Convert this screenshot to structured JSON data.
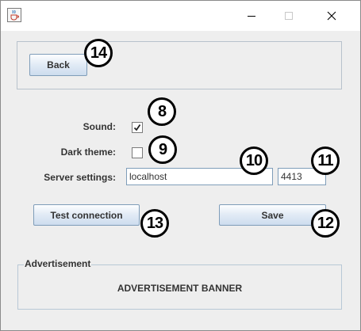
{
  "window": {
    "title": "",
    "icon": "java-cup-icon",
    "controls": {
      "minimize": "minimize-icon",
      "maximize": "maximize-icon",
      "close": "close-icon"
    }
  },
  "nav": {
    "back_label": "Back"
  },
  "settings": {
    "sound_label": "Sound:",
    "sound_checked": true,
    "dark_theme_label": "Dark theme:",
    "dark_theme_checked": false,
    "server_label": "Server settings:",
    "server_host": "localhost",
    "server_port": "4413"
  },
  "actions": {
    "test_label": "Test connection",
    "save_label": "Save"
  },
  "advertisement": {
    "legend": "Advertisement",
    "banner_text": "ADVERTISEMENT BANNER"
  },
  "annotations": {
    "back": "14",
    "sound": "8",
    "dark_theme": "9",
    "host": "10",
    "port": "11",
    "test": "13",
    "save": "12"
  },
  "colors": {
    "window_bg": "#eeeeee",
    "button_border": "#7f9db9",
    "text": "#333333",
    "marker": "#000000"
  }
}
